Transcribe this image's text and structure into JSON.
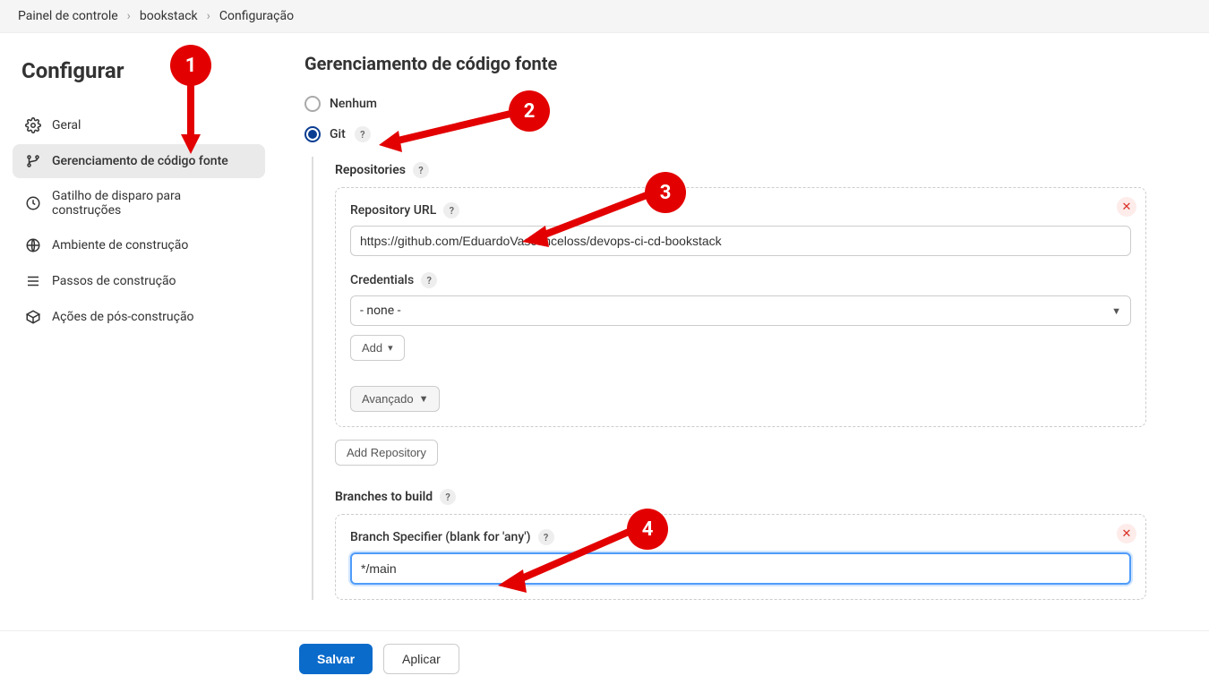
{
  "breadcrumb": {
    "items": [
      "Painel de controle",
      "bookstack",
      "Configuração"
    ]
  },
  "sidebar": {
    "title": "Configurar",
    "items": [
      {
        "label": "Geral",
        "icon": "gear-icon"
      },
      {
        "label": "Gerenciamento de código fonte",
        "icon": "branch-icon",
        "selected": true
      },
      {
        "label": "Gatilho de disparo para construções",
        "icon": "clock-icon"
      },
      {
        "label": "Ambiente de construção",
        "icon": "globe-icon"
      },
      {
        "label": "Passos de construção",
        "icon": "steps-icon"
      },
      {
        "label": "Ações de pós-construção",
        "icon": "package-icon"
      }
    ]
  },
  "main": {
    "heading": "Gerenciamento de código fonte",
    "scm_options": {
      "none_label": "Nenhum",
      "git_label": "Git"
    },
    "repositories": {
      "section_label": "Repositories",
      "repo_url_label": "Repository URL",
      "repo_url_value": "https://github.com/EduardoVasconceloss/devops-ci-cd-bookstack",
      "credentials_label": "Credentials",
      "credentials_value": "- none -",
      "add_label": "Add",
      "advanced_label": "Avançado",
      "add_repo_label": "Add Repository"
    },
    "branches": {
      "section_label": "Branches to build",
      "specifier_label": "Branch Specifier (blank for 'any')",
      "specifier_value": "*/main"
    }
  },
  "footer": {
    "save_label": "Salvar",
    "apply_label": "Aplicar"
  },
  "annotations": {
    "b1": "1",
    "b2": "2",
    "b3": "3",
    "b4": "4"
  }
}
